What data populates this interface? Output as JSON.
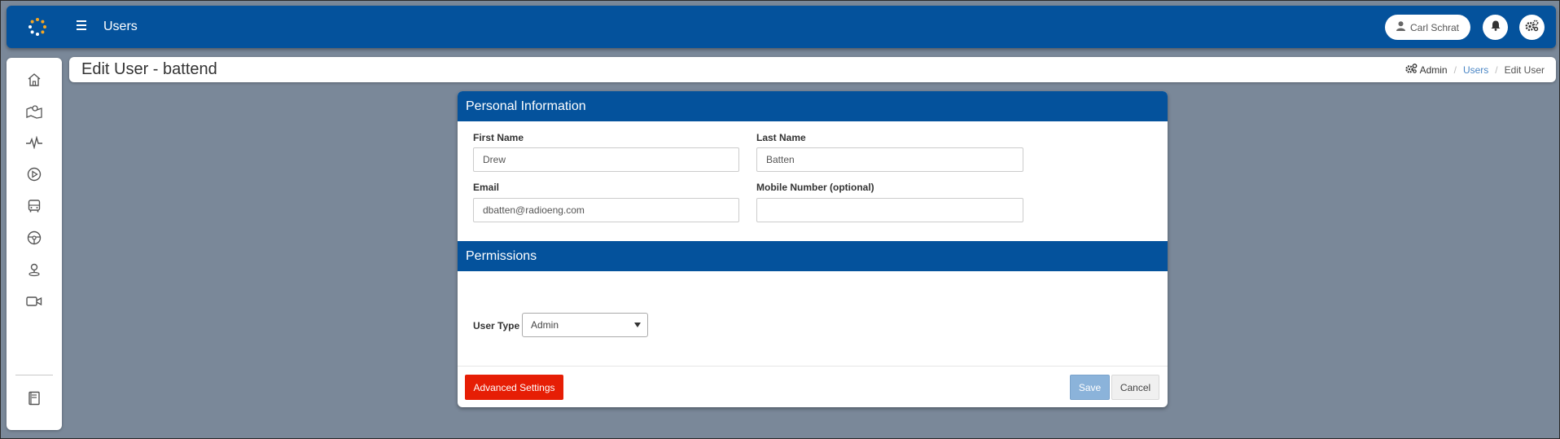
{
  "topbar": {
    "title": "Users",
    "user_name": "Carl Schrat",
    "icons": [
      "logo-icon",
      "menu-icon",
      "user-icon",
      "bell-icon",
      "settings-icon"
    ]
  },
  "sidebar": {
    "items": [
      {
        "name": "home-icon"
      },
      {
        "name": "map-icon"
      },
      {
        "name": "activity-icon"
      },
      {
        "name": "play-icon"
      },
      {
        "name": "bus-icon"
      },
      {
        "name": "steering-wheel-icon"
      },
      {
        "name": "location-icon"
      },
      {
        "name": "video-camera-icon"
      },
      {
        "name": "book-icon"
      }
    ]
  },
  "page": {
    "title": "Edit User - battend",
    "breadcrumb": {
      "admin": "Admin",
      "users": "Users",
      "current": "Edit User"
    }
  },
  "form": {
    "personal_heading": "Personal Information",
    "first_name_label": "First Name",
    "first_name_value": "Drew",
    "last_name_label": "Last Name",
    "last_name_value": "Batten",
    "email_label": "Email",
    "email_value": "dbatten@radioeng.com",
    "mobile_label": "Mobile Number (optional)",
    "mobile_value": "",
    "permissions_heading": "Permissions",
    "user_type_label": "User Type",
    "user_type_value": "Admin"
  },
  "actions": {
    "advanced": "Advanced Settings",
    "save": "Save",
    "cancel": "Cancel"
  },
  "colors": {
    "brand_blue": "#04529c",
    "danger_red": "#e61e05",
    "background": "#7a8899"
  }
}
